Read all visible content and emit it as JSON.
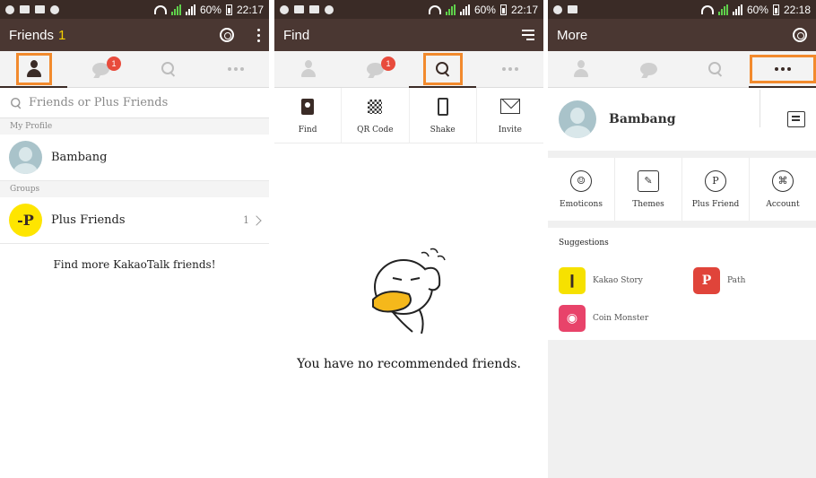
{
  "colors": {
    "statusbar": "#3a2b26",
    "appbar": "#4a3732",
    "highlight": "#f28a2d",
    "badge": "#e84b3c",
    "plus_yellow": "#fee500"
  },
  "status": {
    "battery": "60%",
    "time1": "22:17",
    "time2": "22:17",
    "time3": "22:18"
  },
  "friends": {
    "title": "Friends",
    "count": "1",
    "chat_badge": "1",
    "search_placeholder": "Friends or Plus Friends",
    "section_profile": "My Profile",
    "profile_name": "Bambang",
    "section_groups": "Groups",
    "plus_friends_label": "Plus Friends",
    "plus_friends_count": "1",
    "find_more": "Find more KakaoTalk friends!",
    "icons": [
      "settings-icon",
      "more-vertical-icon",
      "person-icon",
      "chat-icon",
      "search-icon",
      "more-horizontal-icon"
    ]
  },
  "find": {
    "title": "Find",
    "chat_badge": "1",
    "tools": [
      "Find",
      "QR Code",
      "Shake",
      "Invite"
    ],
    "empty_message": "You have no recommended friends."
  },
  "more": {
    "title": "More",
    "profile_name": "Bambang",
    "grid": [
      "Emoticons",
      "Themes",
      "Plus Friend",
      "Account"
    ],
    "suggestions_heading": "Suggestions",
    "apps": [
      "Kakao Story",
      "Path",
      "Coin Monster"
    ]
  }
}
